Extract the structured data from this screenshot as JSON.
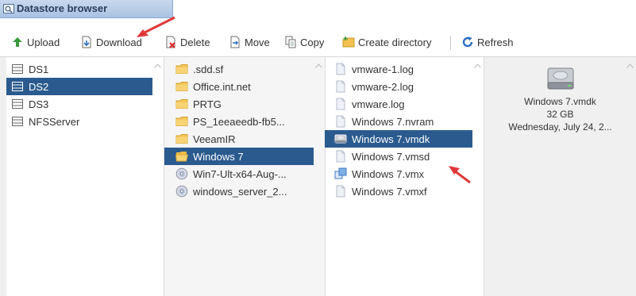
{
  "window": {
    "title": "Datastore browser"
  },
  "toolbar": {
    "upload": "Upload",
    "download": "Download",
    "delete": "Delete",
    "move": "Move",
    "copy": "Copy",
    "create_directory": "Create directory",
    "refresh": "Refresh"
  },
  "datastores": [
    {
      "label": "DS1",
      "selected": false
    },
    {
      "label": "DS2",
      "selected": true
    },
    {
      "label": "DS3",
      "selected": false
    },
    {
      "label": "NFSServer",
      "selected": false
    }
  ],
  "folders": [
    {
      "label": ".sdd.sf",
      "icon": "folder-icon"
    },
    {
      "label": "Office.int.net",
      "icon": "folder-icon"
    },
    {
      "label": "PRTG",
      "icon": "folder-icon"
    },
    {
      "label": "PS_1eeaeedb-fb5...",
      "icon": "folder-icon"
    },
    {
      "label": "VeeamIR",
      "icon": "folder-icon"
    },
    {
      "label": "Windows 7",
      "icon": "folder-open-icon",
      "selected": true
    },
    {
      "label": "Win7-Ult-x64-Aug-...",
      "icon": "disc-icon"
    },
    {
      "label": "windows_server_2...",
      "icon": "disc-icon"
    }
  ],
  "files": [
    {
      "label": "vmware-1.log",
      "icon": "document-icon"
    },
    {
      "label": "vmware-2.log",
      "icon": "document-icon"
    },
    {
      "label": "vmware.log",
      "icon": "document-icon"
    },
    {
      "label": "Windows 7.nvram",
      "icon": "document-icon"
    },
    {
      "label": "Windows 7.vmdk",
      "icon": "disk-icon",
      "selected": true
    },
    {
      "label": "Windows 7.vmsd",
      "icon": "document-icon"
    },
    {
      "label": "Windows 7.vmx",
      "icon": "vm-icon"
    },
    {
      "label": "Windows 7.vmxf",
      "icon": "document-icon"
    }
  ],
  "preview": {
    "name": "Windows 7.vmdk",
    "size": "32 GB",
    "date": "Wednesday, July 24, 2..."
  },
  "colors": {
    "selection": "#2b5b8e",
    "annotation_arrow": "#e0393b"
  }
}
